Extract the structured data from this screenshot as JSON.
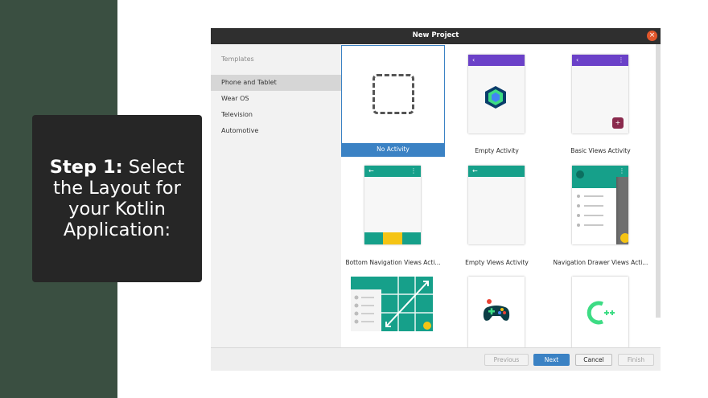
{
  "slide": {
    "step_bold": "Step 1:",
    "step_rest": " Select the Layout for your Kotlin Application:"
  },
  "dialog": {
    "title": "New Project",
    "close_icon": "close-icon",
    "sidebar": {
      "heading": "Templates",
      "items": [
        "Phone and Tablet",
        "Wear OS",
        "Television",
        "Automotive"
      ],
      "selected": "Phone and Tablet"
    },
    "templates": [
      {
        "label": "No Activity",
        "selected": true
      },
      {
        "label": "Empty Activity",
        "selected": false
      },
      {
        "label": "Basic Views Activity",
        "selected": false
      },
      {
        "label": "Bottom Navigation Views Acti...",
        "selected": false
      },
      {
        "label": "Empty Views Activity",
        "selected": false
      },
      {
        "label": "Navigation Drawer Views Acti...",
        "selected": false
      },
      {
        "label": "",
        "selected": false
      },
      {
        "label": "",
        "selected": false
      },
      {
        "label": "",
        "selected": false
      }
    ],
    "buttons": {
      "previous": "Previous",
      "next": "Next",
      "cancel": "Cancel",
      "finish": "Finish"
    },
    "glyphs": {
      "back_arrow": "‹",
      "left_arrow": "←",
      "overflow": "⋮",
      "fab_plus": "+",
      "close_x": "×"
    },
    "colors": {
      "accent_blue": "#3b82c4",
      "purple": "#6b41c8",
      "teal": "#16a08a",
      "yellow": "#f5c414",
      "green_band": "#3a4f41"
    }
  }
}
